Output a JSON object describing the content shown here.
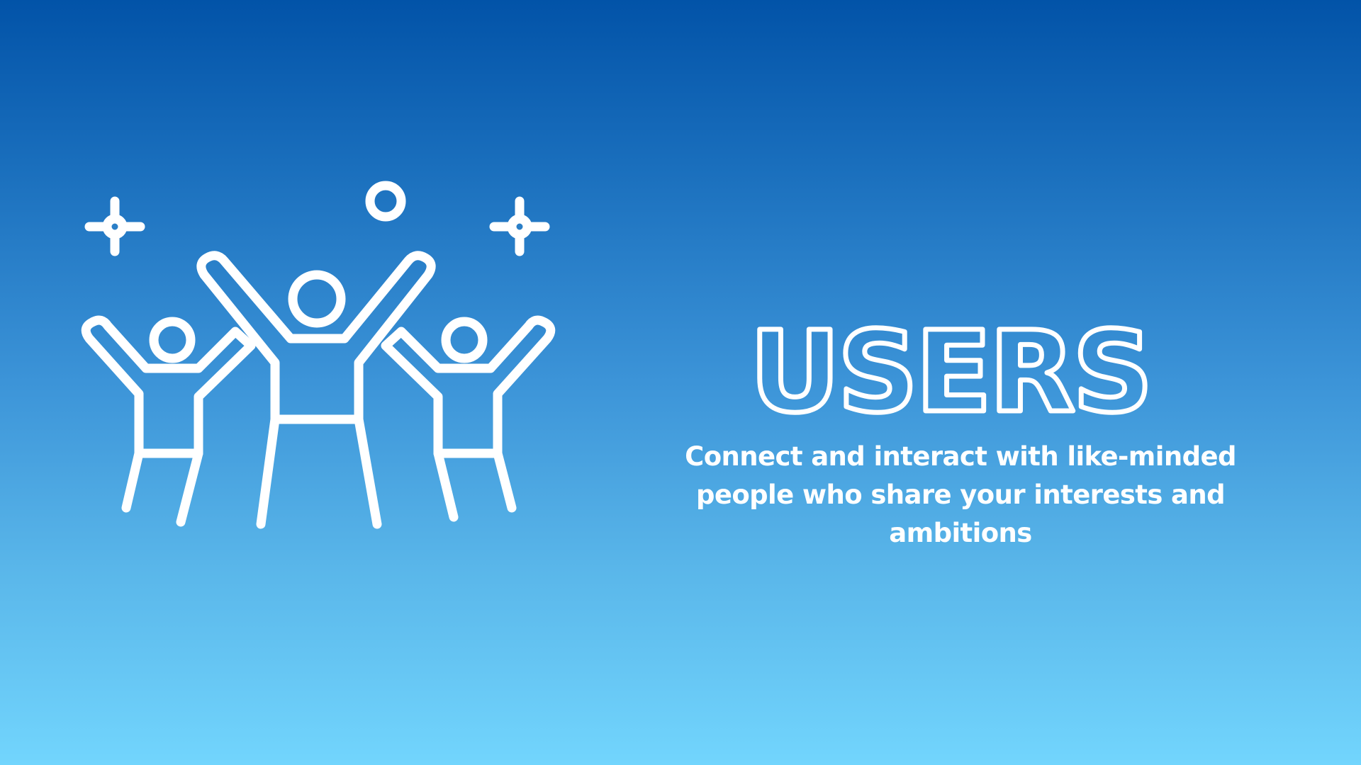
{
  "slide": {
    "illustration_icon": "people-celebrating-icon",
    "title": "USERS",
    "subtitle": "Connect and interact with like-minded people who share your interests and ambitions",
    "colors": {
      "gradient_top": "#0253a8",
      "gradient_bottom": "#72d5fd",
      "foreground": "#ffffff"
    }
  }
}
